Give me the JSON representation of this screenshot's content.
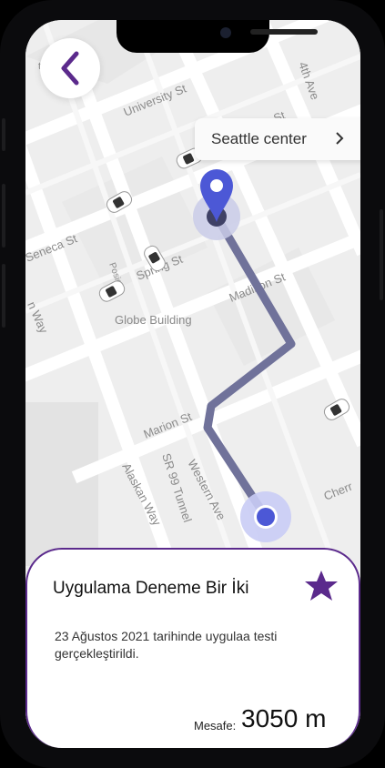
{
  "map": {
    "destination_chip": {
      "label": "Seattle center"
    },
    "streets": [
      "University St",
      "Seneca St",
      "4th Ave",
      "Seneca St",
      "Spring St",
      "Madison St",
      "Marion St",
      "SR 99 Tunnel",
      "Alaskan Way",
      "Western Ave",
      "Cherr",
      "Posie"
    ],
    "poi": [
      "Globe Building",
      "ttle Art Mu"
    ]
  },
  "card": {
    "title": "Uygulama Deneme Bir İki",
    "description": "23 Ağustos 2021 tarihinde uygulaa testi gerçekleştirildi.",
    "distance_label": "Mesafe:",
    "distance_value": "3050 m"
  },
  "colors": {
    "accent": "#5b2a8c",
    "route": "#70729a",
    "pin": "#4c58d6"
  },
  "icons": {
    "back": "chevron-left-icon",
    "chip": "chevron-right-icon",
    "star": "star-icon",
    "pin": "map-pin-icon"
  }
}
